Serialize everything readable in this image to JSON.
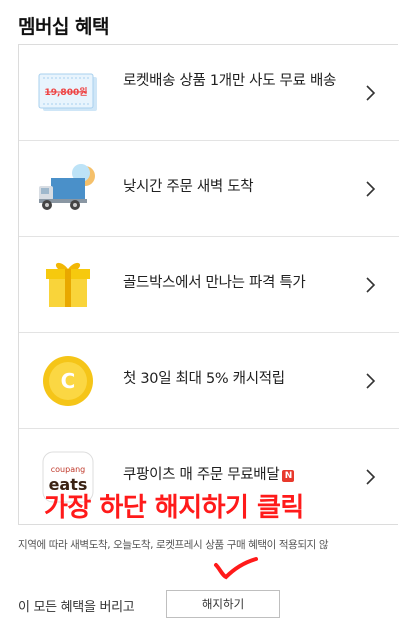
{
  "section_title": "멤버십 혜택",
  "benefits": [
    {
      "label": "로켓배송 상품 1개만 사도 무료 배송",
      "icon": "coupon-ticket-icon",
      "icon_text": "19,800원"
    },
    {
      "label": "낮시간 주문 새벽 도착",
      "icon": "delivery-truck-moon-icon"
    },
    {
      "label": "골드박스에서 만나는 파격 특가",
      "icon": "gift-box-icon"
    },
    {
      "label": "첫 30일 최대 5% 캐시적립",
      "icon": "gold-coin-icon",
      "icon_text": "C"
    },
    {
      "label": "쿠팡이츠 매 주문 무료배달",
      "icon": "coupang-eats-logo-icon",
      "icon_text_top": "coupang",
      "icon_text_bottom": "eats",
      "badge": "N"
    }
  ],
  "overlay_annotation": "가장 하단 해지하기 클릭",
  "notice": "지역에 따라 새벽도착, 오늘도착, 로켓프레시 상품 구매 혜택이 적용되지 않",
  "cancel_prompt": "이 모든 혜택을 버리고",
  "cancel_button": "해지하기",
  "colors": {
    "annotation_red": "#ff1a1a",
    "coin_gold": "#f5c518",
    "badge_red": "#e8392c"
  }
}
